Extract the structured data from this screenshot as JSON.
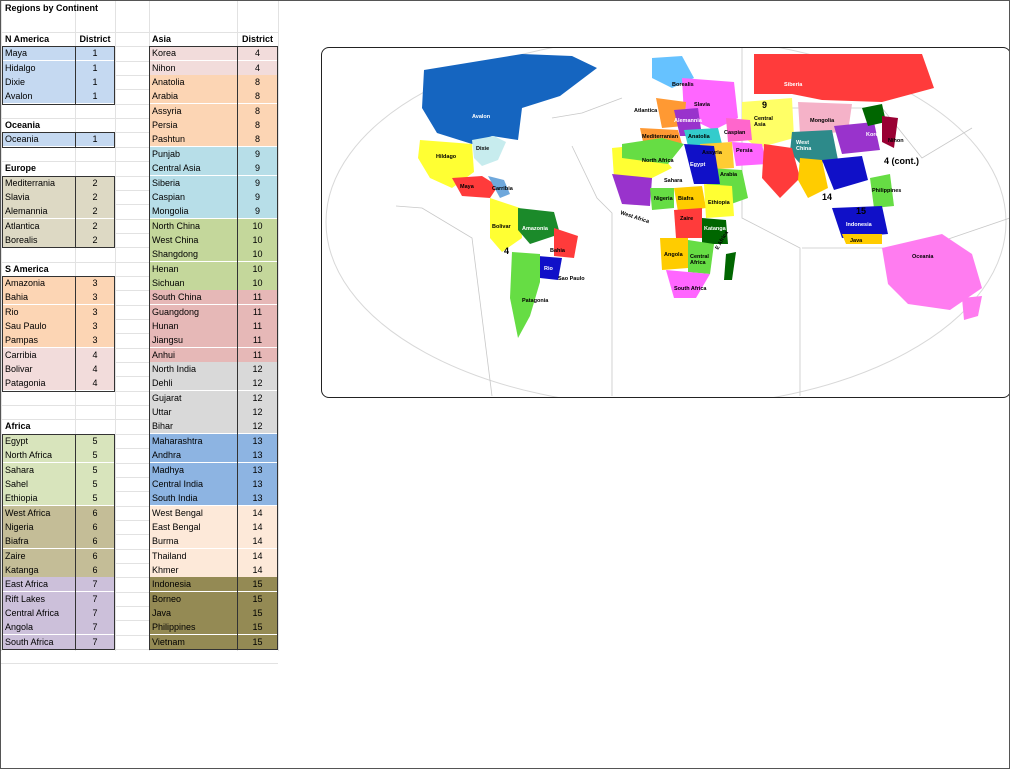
{
  "sheet": {
    "title": "Regions by Continent"
  },
  "left_tables": [
    {
      "header": "N America",
      "district_header": "District",
      "color": "#c5d9f1",
      "rows": [
        [
          "Maya",
          "1"
        ],
        [
          "Hidalgo",
          "1"
        ],
        [
          "Dixie",
          "1"
        ],
        [
          "Avalon",
          "1"
        ]
      ]
    },
    {
      "header": "Oceania",
      "district_header": "",
      "color": "#c5d9f1",
      "rows": [
        [
          "Oceania",
          "1"
        ]
      ]
    },
    {
      "header": "Europe",
      "district_header": "",
      "color": "#ddd9c4",
      "rows": [
        [
          "Mediterrania",
          "2"
        ],
        [
          "Slavia",
          "2"
        ],
        [
          "Alemannia",
          "2"
        ],
        [
          "Atlantica",
          "2"
        ],
        [
          "Borealis",
          "2"
        ]
      ]
    },
    {
      "header": "S America",
      "district_header": "",
      "groups": [
        {
          "color": "#fcd5b4",
          "rows": [
            [
              "Amazonia",
              "3"
            ],
            [
              "Bahia",
              "3"
            ],
            [
              "Rio",
              "3"
            ],
            [
              "Sau Paulo",
              "3"
            ],
            [
              "Pampas",
              "3"
            ]
          ]
        },
        {
          "color": "#f2dcdb",
          "rows": [
            [
              "Carribia",
              "4"
            ],
            [
              "Bolivar",
              "4"
            ],
            [
              "Patagonia",
              "4"
            ]
          ]
        }
      ]
    },
    {
      "header": "Africa",
      "district_header": "",
      "groups": [
        {
          "color": "#d8e4bc",
          "rows": [
            [
              "Egypt",
              "5"
            ],
            [
              "North Africa",
              "5"
            ],
            [
              "Sahara",
              "5"
            ],
            [
              "Sahel",
              "5"
            ],
            [
              "Ethiopia",
              "5"
            ]
          ]
        },
        {
          "color": "#c4bd97",
          "rows": [
            [
              "West Africa",
              "6"
            ],
            [
              "Nigeria",
              "6"
            ],
            [
              "Biafra",
              "6"
            ],
            [
              "Zaire",
              "6"
            ],
            [
              "Katanga",
              "6"
            ]
          ]
        },
        {
          "color": "#ccc0da",
          "rows": [
            [
              "East Africa",
              "7"
            ],
            [
              "Rift Lakes",
              "7"
            ],
            [
              "Central Africa",
              "7"
            ],
            [
              "Angola",
              "7"
            ],
            [
              "South Africa",
              "7"
            ]
          ]
        }
      ]
    }
  ],
  "asia_table": {
    "header": "Asia",
    "district_header": "District",
    "groups": [
      {
        "color": "#f2dcdb",
        "rows": [
          [
            "Korea",
            "4"
          ],
          [
            "Nihon",
            "4"
          ]
        ]
      },
      {
        "color": "#fcd5b4",
        "rows": [
          [
            "Anatolia",
            "8"
          ],
          [
            "Arabia",
            "8"
          ],
          [
            "Assyria",
            "8"
          ],
          [
            "Persia",
            "8"
          ],
          [
            "Pashtun",
            "8"
          ]
        ]
      },
      {
        "color": "#b7dee8",
        "rows": [
          [
            "Punjab",
            "9"
          ],
          [
            "Central Asia",
            "9"
          ],
          [
            "Siberia",
            "9"
          ],
          [
            "Caspian",
            "9"
          ],
          [
            "Mongolia",
            "9"
          ]
        ]
      },
      {
        "color": "#c4d79b",
        "rows": [
          [
            "North China",
            "10"
          ],
          [
            "West China",
            "10"
          ],
          [
            "Shangdong",
            "10"
          ],
          [
            "Henan",
            "10"
          ],
          [
            "Sichuan",
            "10"
          ]
        ]
      },
      {
        "color": "#e6b8b7",
        "rows": [
          [
            "South China",
            "11"
          ],
          [
            "Guangdong",
            "11"
          ],
          [
            "Hunan",
            "11"
          ],
          [
            "Jiangsu",
            "11"
          ],
          [
            "Anhui",
            "11"
          ]
        ]
      },
      {
        "color": "#d9d9d9",
        "rows": [
          [
            "North India",
            "12"
          ],
          [
            "Dehli",
            "12"
          ],
          [
            "Gujarat",
            "12"
          ],
          [
            "Uttar",
            "12"
          ],
          [
            "Bihar",
            "12"
          ]
        ]
      },
      {
        "color": "#8db4e2",
        "rows": [
          [
            "Maharashtra",
            "13"
          ],
          [
            "Andhra",
            "13"
          ],
          [
            "Madhya",
            "13"
          ],
          [
            "Central India",
            "13"
          ],
          [
            "South India",
            "13"
          ]
        ]
      },
      {
        "color": "#fde9d9",
        "rows": [
          [
            "West Bengal",
            "14"
          ],
          [
            "East Bengal",
            "14"
          ],
          [
            "Burma",
            "14"
          ],
          [
            "Thailand",
            "14"
          ],
          [
            "Khmer",
            "14"
          ]
        ]
      },
      {
        "color": "#948a54",
        "rows": [
          [
            "Indonesia",
            "15"
          ],
          [
            "Borneo",
            "15"
          ],
          [
            "Java",
            "15"
          ],
          [
            "Philippines",
            "15"
          ],
          [
            "Vietnam",
            "15"
          ]
        ]
      }
    ]
  },
  "map": {
    "labels": {
      "siberia": "Siberia",
      "mongolia": "Mongolia",
      "central_asia": "Central\nAsia",
      "borealis": "Borealis",
      "slavia": "Slavia",
      "atlantica": "Atlantica",
      "alemannia": "Alemannia",
      "mediterrania": "Mediterranian",
      "anatolia": "Anatolia",
      "caspian": "Caspian",
      "assyria": "Assyria",
      "persia": "Persia",
      "arabia": "Arabia",
      "egypt": "Egypt",
      "north_africa": "North Africa",
      "sahara": "Sahara",
      "west_africa": "West Africa",
      "nigeria": "Nigeria",
      "biafra": "Biafra",
      "zaire": "Zaire",
      "katanga": "Katanga",
      "ethiopia": "Ethiopia",
      "east_africa": "E Africa",
      "angola": "Angola",
      "central_africa": "Central\nAfrica",
      "south_africa": "South Africa",
      "avalon": "Avalon",
      "hidalgo": "Hildago",
      "dixie": "Dixie",
      "maya": "Maya",
      "carribia": "Carribia",
      "bolivar": "Bolivar",
      "amazonia": "Amazonia",
      "bahia": "Bahia",
      "rio": "Rio",
      "sao_paulo": "Sao Paulo",
      "patagonia": "Patagonia",
      "west_china": "West\nChina",
      "korea": "Korea",
      "nihon": "Nihon",
      "philippines": "Philippines",
      "indonesia": "Indonesia",
      "java": "Java",
      "oceania": "Oceania",
      "four_cont": "4 (cont.)"
    },
    "numbers": {
      "n9": "9",
      "n4a": "4",
      "n14": "14",
      "n15": "15"
    },
    "colors": {
      "north_america": "#1565c0",
      "siberia": "#ff3b3b",
      "oceania": "#ff7cf0",
      "amazonia": "#1b8a2a"
    }
  }
}
